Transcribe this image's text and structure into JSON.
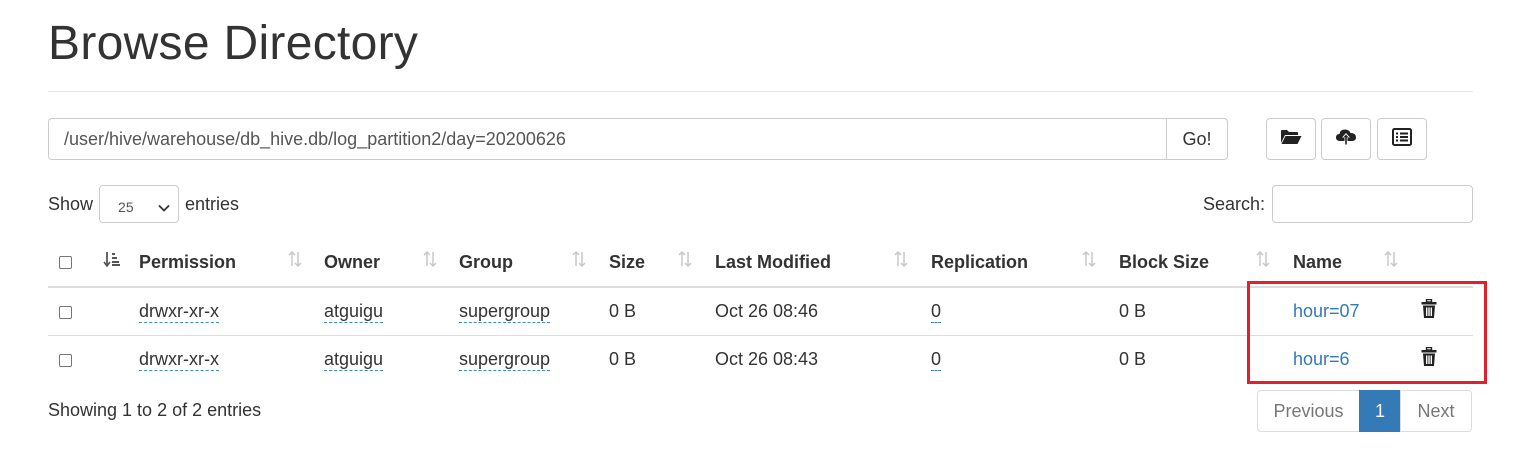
{
  "page": {
    "title": "Browse Directory"
  },
  "path_bar": {
    "path_value": "/user/hive/warehouse/db_hive.db/log_partition2/day=20200626",
    "go_label": "Go!"
  },
  "toolbar": {
    "icons": [
      "folder-open-icon",
      "cloud-upload-icon",
      "list-alt-icon"
    ]
  },
  "length_control": {
    "show_label": "Show",
    "selected": "25",
    "entries_label": "entries"
  },
  "search": {
    "label": "Search:",
    "value": ""
  },
  "table": {
    "columns": [
      "Permission",
      "Owner",
      "Group",
      "Size",
      "Last Modified",
      "Replication",
      "Block Size",
      "Name"
    ],
    "rows": [
      {
        "permission": "drwxr-xr-x",
        "owner": "atguigu",
        "group": "supergroup",
        "size": "0 B",
        "last_modified": "Oct 26 08:46",
        "replication": "0",
        "block_size": "0 B",
        "name": "hour=07"
      },
      {
        "permission": "drwxr-xr-x",
        "owner": "atguigu",
        "group": "supergroup",
        "size": "0 B",
        "last_modified": "Oct 26 08:43",
        "replication": "0",
        "block_size": "0 B",
        "name": "hour=6"
      }
    ]
  },
  "footer": {
    "info": "Showing 1 to 2 of 2 entries",
    "pagination": {
      "previous": "Previous",
      "current": "1",
      "next": "Next"
    }
  },
  "colors": {
    "link": "#337ab7",
    "active_page": "#337ab7",
    "highlight_box": "#e0202a"
  }
}
